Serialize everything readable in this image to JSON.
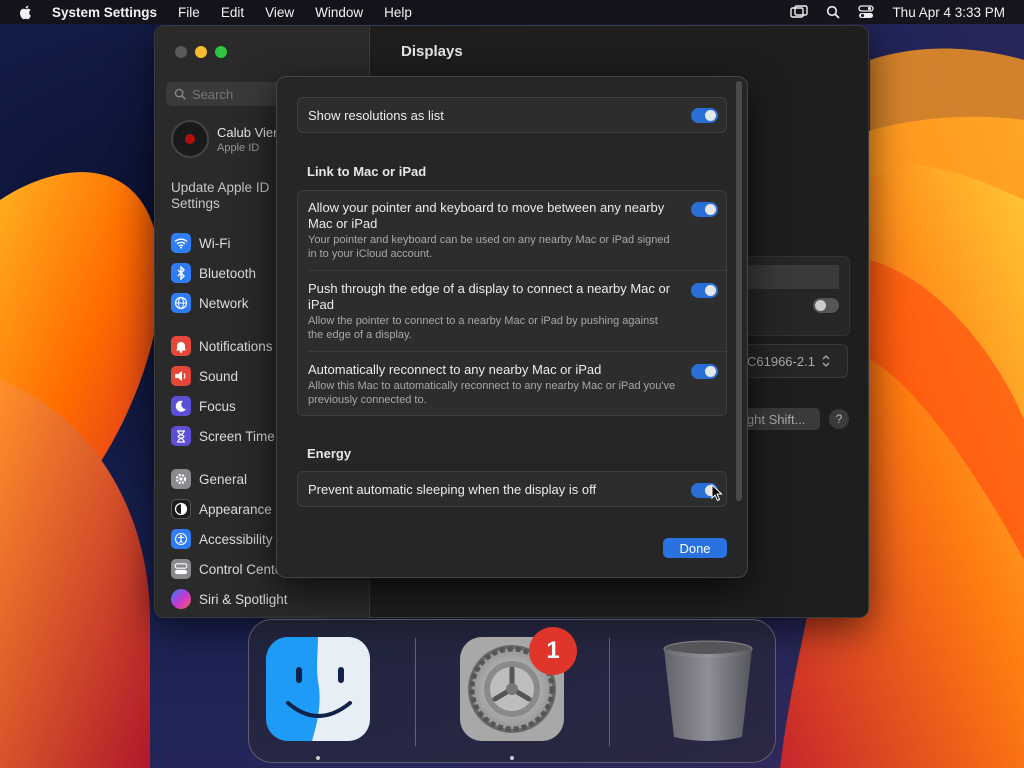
{
  "menubar": {
    "app_name": "System Settings",
    "items": [
      "File",
      "Edit",
      "View",
      "Window",
      "Help"
    ],
    "clock": "Thu Apr 4  3:33 PM"
  },
  "sidebar": {
    "search_placeholder": "Search",
    "profile": {
      "name": "Calub Vier",
      "sub": "Apple ID"
    },
    "update_text": "Update Apple ID Settings",
    "items": [
      {
        "label": "Wi-Fi",
        "icon": "wifi-icon",
        "color": "#2f7cf6"
      },
      {
        "label": "Bluetooth",
        "icon": "bluetooth-icon",
        "color": "#2f7cf6"
      },
      {
        "label": "Network",
        "icon": "globe-icon",
        "color": "#2f7cf6"
      },
      {
        "label": "Notifications",
        "icon": "bell-icon",
        "color": "#e5473b"
      },
      {
        "label": "Sound",
        "icon": "speaker-icon",
        "color": "#e5473b"
      },
      {
        "label": "Focus",
        "icon": "moon-icon",
        "color": "#5b4fd6"
      },
      {
        "label": "Screen Time",
        "icon": "hourglass-icon",
        "color": "#5b4fd6"
      },
      {
        "label": "General",
        "icon": "gear-icon",
        "color": "#8a8a8e"
      },
      {
        "label": "Appearance",
        "icon": "appearance-icon",
        "color": "#1c1c1e"
      },
      {
        "label": "Accessibility",
        "icon": "accessibility-icon",
        "color": "#2f7cf6"
      },
      {
        "label": "Control Cente",
        "icon": "control-center-icon",
        "color": "#8a8a8e"
      },
      {
        "label": "Siri & Spotlight",
        "icon": "siri-icon",
        "color": "#c03ad8"
      }
    ]
  },
  "main": {
    "title": "Displays",
    "display_select": "C61966-2.1",
    "night_shift_button": "ight Shift...",
    "help_label": "?"
  },
  "sheet": {
    "show_resolutions": {
      "label": "Show resolutions as list",
      "on": true
    },
    "section_link": "Link to Mac or iPad",
    "link_rows": [
      {
        "title": "Allow your pointer and keyboard to move between any nearby Mac or iPad",
        "desc": "Your pointer and keyboard can be used on any nearby Mac or iPad signed in to your iCloud account.",
        "on": true
      },
      {
        "title": "Push through the edge of a display to connect a nearby Mac or iPad",
        "desc": "Allow the pointer to connect to a nearby Mac or iPad by pushing against the edge of a display.",
        "on": true
      },
      {
        "title": "Automatically reconnect to any nearby Mac or iPad",
        "desc": "Allow this Mac to automatically reconnect to any nearby Mac or iPad you've previously connected to.",
        "on": true
      }
    ],
    "section_energy": "Energy",
    "prevent_sleep": {
      "label": "Prevent automatic sleeping when the display is off",
      "on": true
    },
    "done_label": "Done"
  },
  "dock": {
    "apps": [
      {
        "name": "Finder",
        "icon": "finder-icon",
        "running": true
      },
      {
        "name": "System Settings",
        "icon": "settings-gear-icon",
        "running": true,
        "badge": "1"
      },
      {
        "name": "Trash",
        "icon": "trash-icon",
        "running": false
      }
    ]
  },
  "colors": {
    "accent": "#2a72e0",
    "badge": "#e0352b"
  }
}
